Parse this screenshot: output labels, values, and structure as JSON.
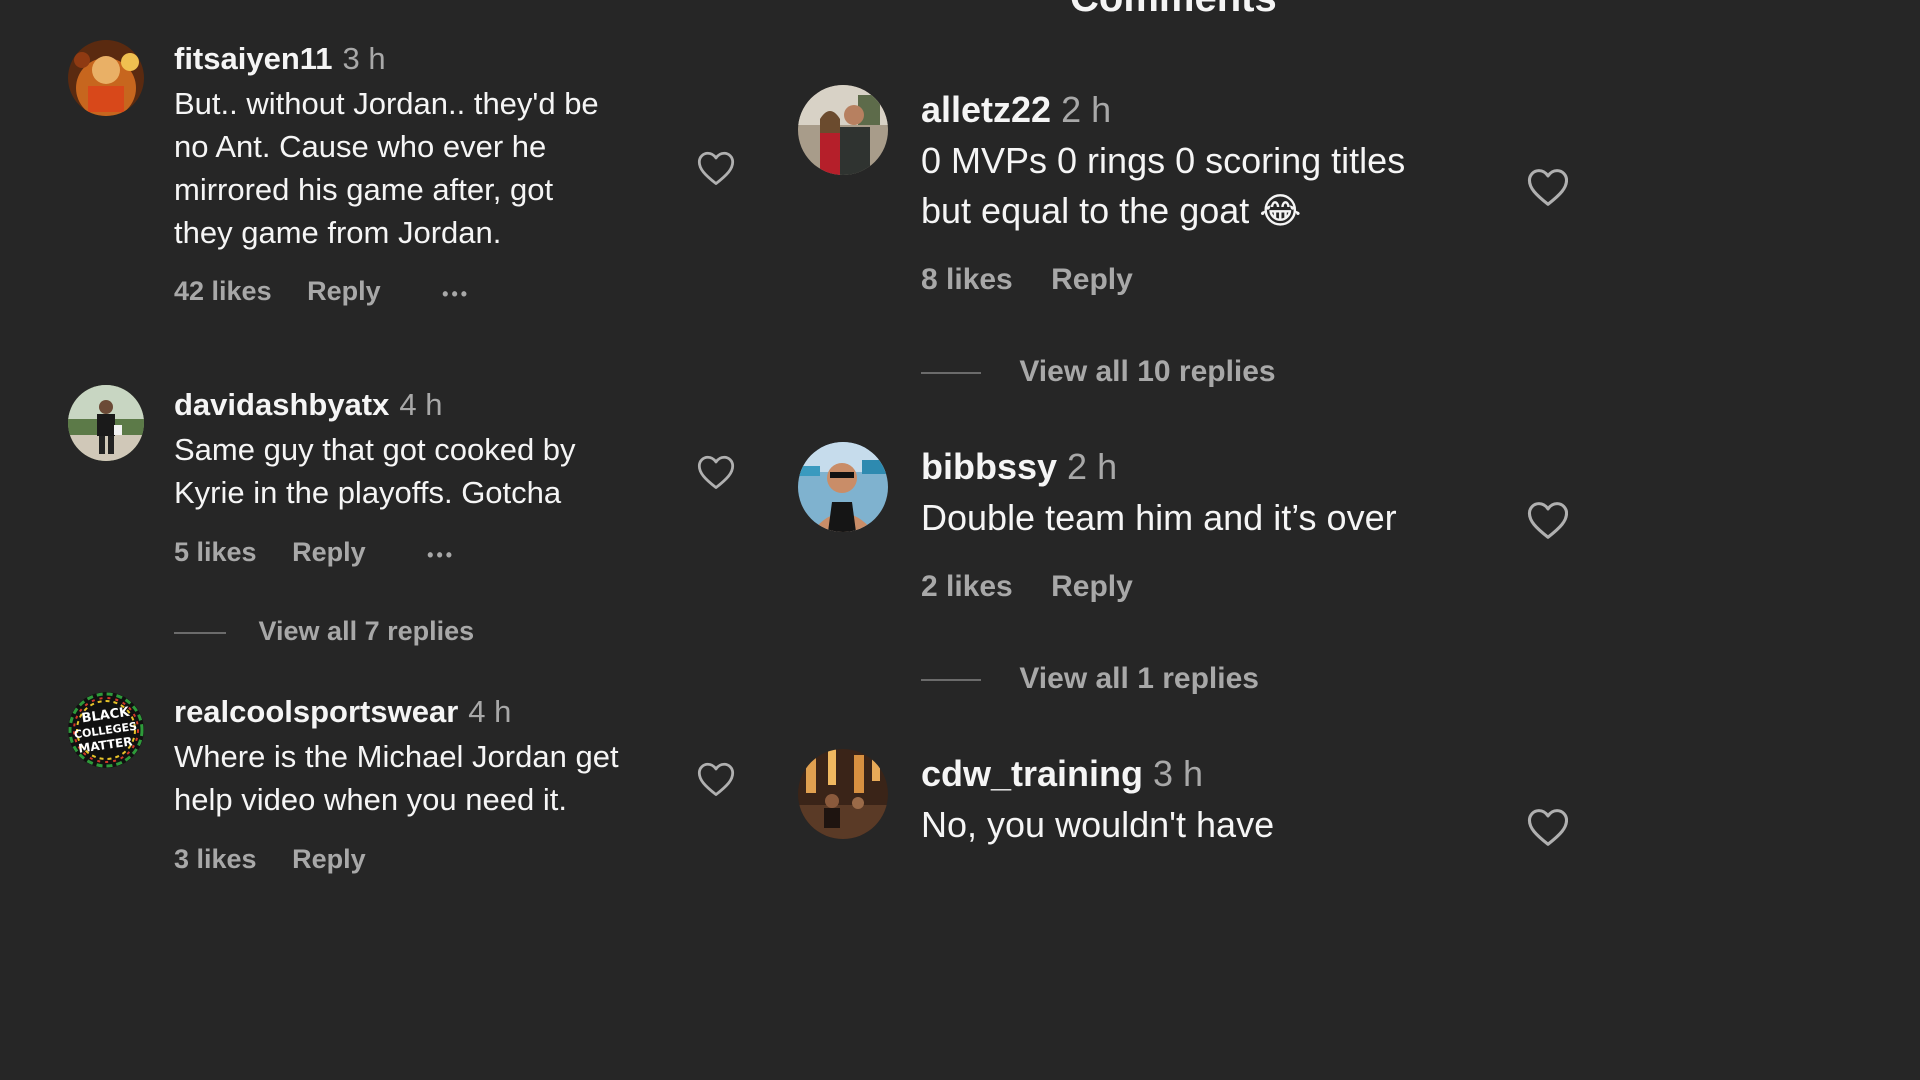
{
  "header": {
    "title": "Comments"
  },
  "left_comments": [
    {
      "username": "fitsaiyen11",
      "time": "3 h",
      "text_lines": [
        "But.. without Jordan.. they'd be",
        "no Ant. Cause who ever he",
        "mirrored his game after, got",
        "they game from Jordan."
      ],
      "likes": "42 likes",
      "reply": "Reply",
      "more": "•••",
      "avatar": "avatar-fitsaiyen11"
    },
    {
      "username": "davidashbyatx",
      "time": "4 h",
      "text_lines": [
        "Same guy that got cooked by",
        "Kyrie in the playoffs. Gotcha"
      ],
      "likes": "5 likes",
      "reply": "Reply",
      "more": "•••",
      "view_replies": "View all 7 replies",
      "avatar": "avatar-davidashbyatx"
    },
    {
      "username": "realcoolsportswear",
      "time": "4 h",
      "text_lines": [
        "Where is the Michael Jordan get",
        "help video when you need it."
      ],
      "likes": "3 likes",
      "reply": "Reply",
      "avatar": "avatar-realcoolsportswear",
      "avatar_badge_text": "BLACK COLLEGES MATTER"
    }
  ],
  "right_comments": [
    {
      "username": "alletz22",
      "time": "2 h",
      "text_lines": [
        "0 MVPs 0 rings 0 scoring titles",
        "but equal to the goat 😂"
      ],
      "likes": "8 likes",
      "reply": "Reply",
      "view_replies": "View all 10 replies",
      "avatar": "avatar-alletz22"
    },
    {
      "username": "bibbssy",
      "time": "2 h",
      "text_lines": [
        "Double team him and it’s over"
      ],
      "likes": "2 likes",
      "reply": "Reply",
      "view_replies": "View all 1 replies",
      "avatar": "avatar-bibbssy"
    },
    {
      "username": "cdw_training",
      "time": "3 h",
      "text_lines": [
        "No, you wouldn't have"
      ],
      "avatar": "avatar-cdw_training"
    }
  ],
  "icons": {
    "heart": "heart-outline-icon",
    "close": "close-icon"
  },
  "colors": {
    "background": "#262626",
    "primary_text": "#f5f5f5",
    "secondary_text": "#a8a8a8"
  }
}
